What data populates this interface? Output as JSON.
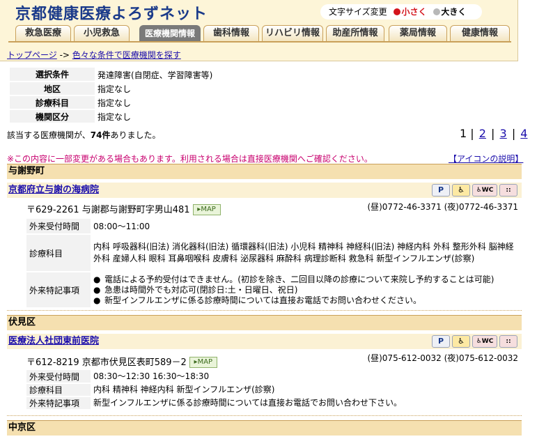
{
  "header": {
    "site_title": "京都健康医療よろずネット",
    "font_size_label": "文字サイズ変更",
    "font_small": "小さく",
    "font_large": "大きく"
  },
  "tabs": [
    {
      "label": "救急医療",
      "active": false
    },
    {
      "label": "小児救急",
      "active": false
    },
    {
      "label": "医療機関情報",
      "active": true
    },
    {
      "label": "歯科情報",
      "active": false
    },
    {
      "label": "リハビリ情報",
      "active": false
    },
    {
      "label": "助産所情報",
      "active": false
    },
    {
      "label": "薬局情報",
      "active": false
    },
    {
      "label": "健康情報",
      "active": false
    }
  ],
  "breadcrumb": {
    "home": "トップページ",
    "sep": " -> ",
    "current": "色々な条件で医療機関を探す"
  },
  "conditions": [
    {
      "label": "選択条件",
      "value": "発達障害(自閉症、学習障害等)"
    },
    {
      "label": "地区",
      "value": "指定なし"
    },
    {
      "label": "診療科目",
      "value": "指定なし"
    },
    {
      "label": "機関区分",
      "value": "指定なし"
    }
  ],
  "result": {
    "prefix": "該当する医療機関が、",
    "count": "74件",
    "suffix": "ありました。"
  },
  "pager": {
    "pages": [
      "1",
      "2",
      "3",
      "4"
    ],
    "sep": "|"
  },
  "notice": "※この内容に一部変更がある場合もあります。利用される場合は直接医療機関へご確認ください。",
  "icon_help": "【アイコンの説明】",
  "icons": {
    "parking": "P",
    "wc": "WC",
    "other": "::"
  },
  "map_label": "MAP",
  "labels": {
    "hours": "外来受付時間",
    "depts": "診療科目",
    "notes": "外来特記事項"
  },
  "regions": {
    "r1": "与謝野町",
    "r2": "伏見区",
    "r3": "中京区"
  },
  "hospital1": {
    "name": "京都府立与謝の海病院",
    "address": "〒629-2261 与謝郡与謝野町字男山481",
    "tel": "(昼)0772-46-3371 (夜)0772-46-3371",
    "hours": "08:00～11:00",
    "depts": "内科 呼吸器科(旧法) 消化器科(旧法) 循環器科(旧法) 小児科 精神科 神経科(旧法) 神経内科 外科 整形外科 脳神経外科 産婦人科 眼科 耳鼻咽喉科 皮膚科 泌尿器科 麻酔科 病理診断科 救急科 新型インフルエンザ(診察)",
    "note1": "電話による予約受付はできません。(初診を除き、二回目以降の診療について来院し予約することは可能)",
    "note2": "急患は時間外でも対応可(閉診日:土・日曜日、祝日)",
    "note3": "新型インフルエンザに係る診療時間については直接お電話でお問い合わせください。"
  },
  "hospital2": {
    "name": "医療法人社団東前医院",
    "address": "〒612-8219 京都市伏見区表町589－2",
    "tel": "(昼)075-612-0032 (夜)075-612-0032",
    "hours": "08:30～12:30 16:30～18:30",
    "depts": "内科 精神科 神経内科 新型インフルエンザ(診察)",
    "note": "新型インフルエンザに係る診療時間については直接お電話でお問い合わせ下さい。"
  }
}
